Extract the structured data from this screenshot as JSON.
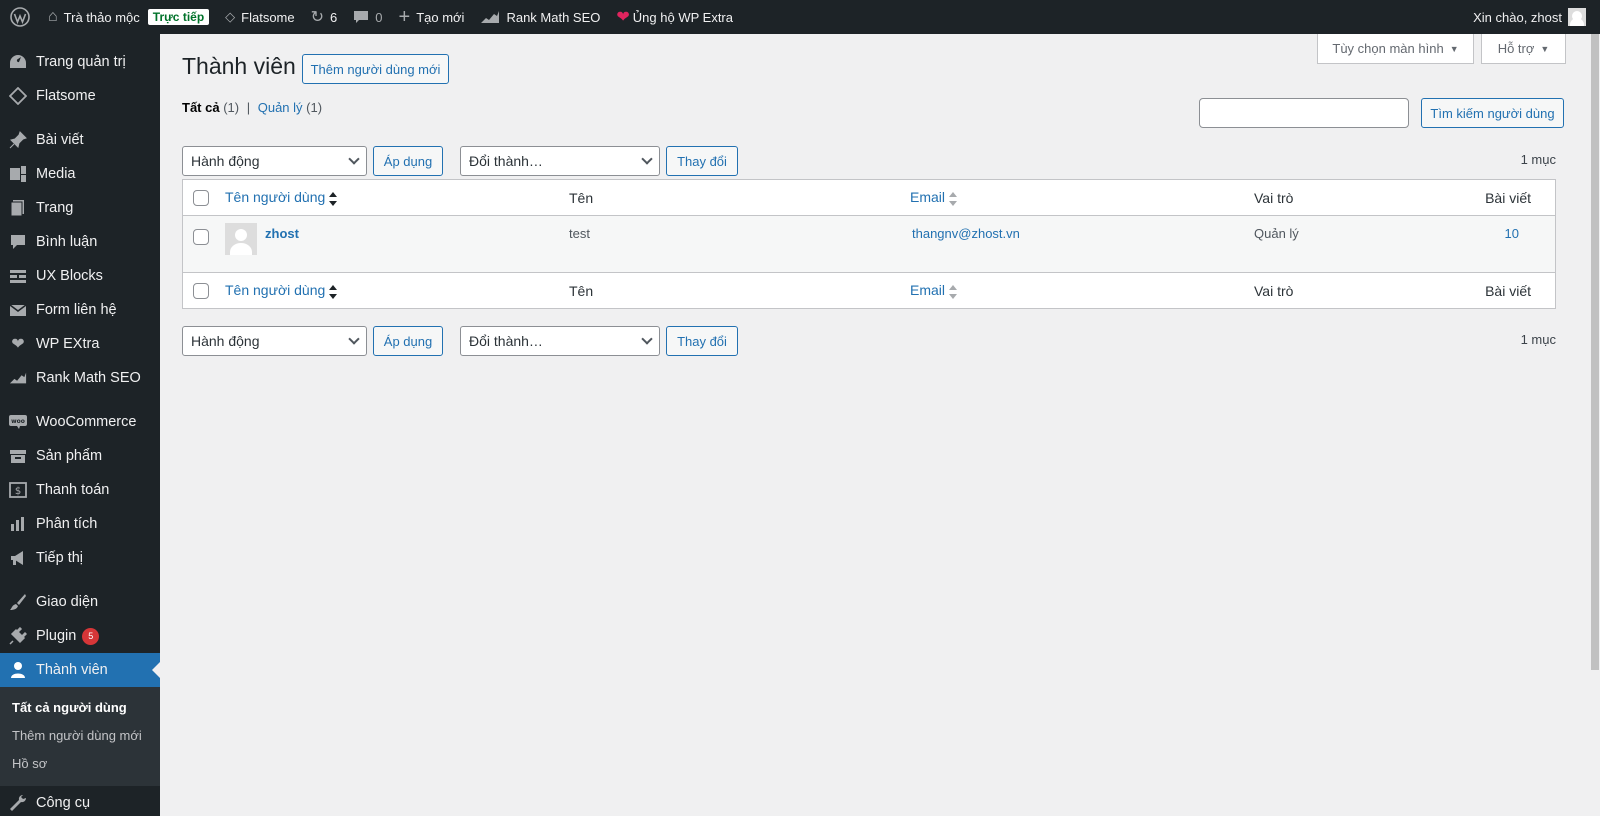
{
  "adminbar": {
    "site_name": "Trà thảo mộc",
    "live_badge": "Trực tiếp",
    "theme": "Flatsome",
    "updates_count": "6",
    "comments_count": "0",
    "new_label": "Tạo mới",
    "rankmath_label": "Rank Math SEO",
    "support_label": "Ủng hộ WP Extra",
    "greeting": "Xin chào, zhost"
  },
  "sidebar": {
    "items": [
      {
        "label": "Trang quản trị",
        "icon": "dashboard-icon"
      },
      {
        "label": "Flatsome",
        "icon": "flatsome-icon"
      },
      {
        "label": "Bài viết",
        "icon": "pin-icon"
      },
      {
        "label": "Media",
        "icon": "media-icon"
      },
      {
        "label": "Trang",
        "icon": "page-icon"
      },
      {
        "label": "Bình luận",
        "icon": "comment-icon"
      },
      {
        "label": "UX Blocks",
        "icon": "blocks-icon"
      },
      {
        "label": "Form liên hệ",
        "icon": "mail-icon"
      },
      {
        "label": "WP EXtra",
        "icon": "heart-icon"
      },
      {
        "label": "Rank Math SEO",
        "icon": "rankmath-icon"
      },
      {
        "label": "WooCommerce",
        "icon": "woo-icon"
      },
      {
        "label": "Sản phẩm",
        "icon": "archive-icon"
      },
      {
        "label": "Thanh toán",
        "icon": "dollar-icon"
      },
      {
        "label": "Phân tích",
        "icon": "chart-icon"
      },
      {
        "label": "Tiếp thị",
        "icon": "megaphone-icon"
      },
      {
        "label": "Giao diện",
        "icon": "brush-icon"
      },
      {
        "label": "Plugin",
        "icon": "plugin-icon",
        "badge": "5"
      },
      {
        "label": "Thành viên",
        "icon": "user-icon"
      },
      {
        "label": "Công cụ",
        "icon": "wrench-icon"
      }
    ],
    "submenu": [
      "Tất cả người dùng",
      "Thêm người dùng mới",
      "Hồ sơ"
    ]
  },
  "screen_meta": {
    "screen_options": "Tùy chọn màn hình",
    "help": "Hỗ trợ"
  },
  "page": {
    "title": "Thành viên",
    "add_new": "Thêm người dùng mới",
    "filter_all": "Tất cả",
    "filter_all_count": "(1)",
    "filter_sep": "|",
    "filter_admin": "Quản lý",
    "filter_admin_count": "(1)",
    "search_value": "",
    "search_button": "Tìm kiếm người dùng",
    "bulk_action": "Hành động",
    "apply": "Áp dụng",
    "change_role": "Đổi thành…",
    "change": "Thay đổi",
    "items_count": "1 mục"
  },
  "table": {
    "headers": {
      "username": "Tên người dùng",
      "name": "Tên",
      "email": "Email",
      "role": "Vai trò",
      "posts": "Bài viết"
    },
    "rows": [
      {
        "username": "zhost",
        "name": "test",
        "email": "thangnv@zhost.vn",
        "role": "Quản lý",
        "posts": "10"
      }
    ]
  }
}
